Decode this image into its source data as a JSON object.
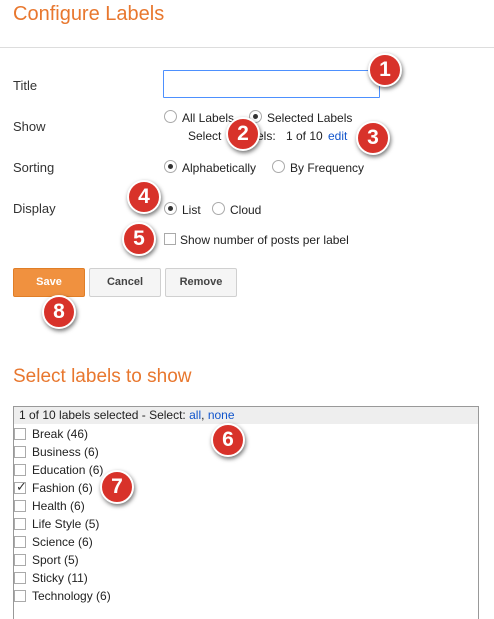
{
  "header": {
    "title": "Configure Labels"
  },
  "form": {
    "title_label": "Title",
    "title_value": "",
    "show_label": "Show",
    "show_options": {
      "all": "All Labels",
      "selected": "Selected Labels"
    },
    "selected_summary_prefix": "Select",
    "selected_summary_suffix": "els:",
    "selected_count": "1 of 10",
    "edit_link": "edit",
    "sorting_label": "Sorting",
    "sorting_options": {
      "alpha": "Alphabetically",
      "freq": "By Frequency"
    },
    "display_label": "Display",
    "display_options": {
      "list": "List",
      "cloud": "Cloud"
    },
    "show_posts_label": "Show number of posts per label"
  },
  "buttons": {
    "save": "Save",
    "cancel": "Cancel",
    "remove": "Remove"
  },
  "select_section": {
    "title": "Select labels to show",
    "header_text": "1 of 10 labels selected - Select:",
    "select_all": "all",
    "separator": ",",
    "select_none": "none",
    "items": [
      {
        "label": "Break (46)",
        "checked": false
      },
      {
        "label": "Business (6)",
        "checked": false
      },
      {
        "label": "Education (6)",
        "checked": false
      },
      {
        "label": "Fashion (6)",
        "checked": true
      },
      {
        "label": "Health (6)",
        "checked": false
      },
      {
        "label": "Life Style (5)",
        "checked": false
      },
      {
        "label": "Science (6)",
        "checked": false
      },
      {
        "label": "Sport (5)",
        "checked": false
      },
      {
        "label": "Sticky (11)",
        "checked": false
      },
      {
        "label": "Technology (6)",
        "checked": false
      }
    ]
  },
  "callouts": [
    "1",
    "2",
    "3",
    "4",
    "5",
    "6",
    "7",
    "8"
  ],
  "colors": {
    "accent": "#e8772e",
    "save": "#f0913f",
    "badge": "#d8322a",
    "link": "#1155cc"
  }
}
